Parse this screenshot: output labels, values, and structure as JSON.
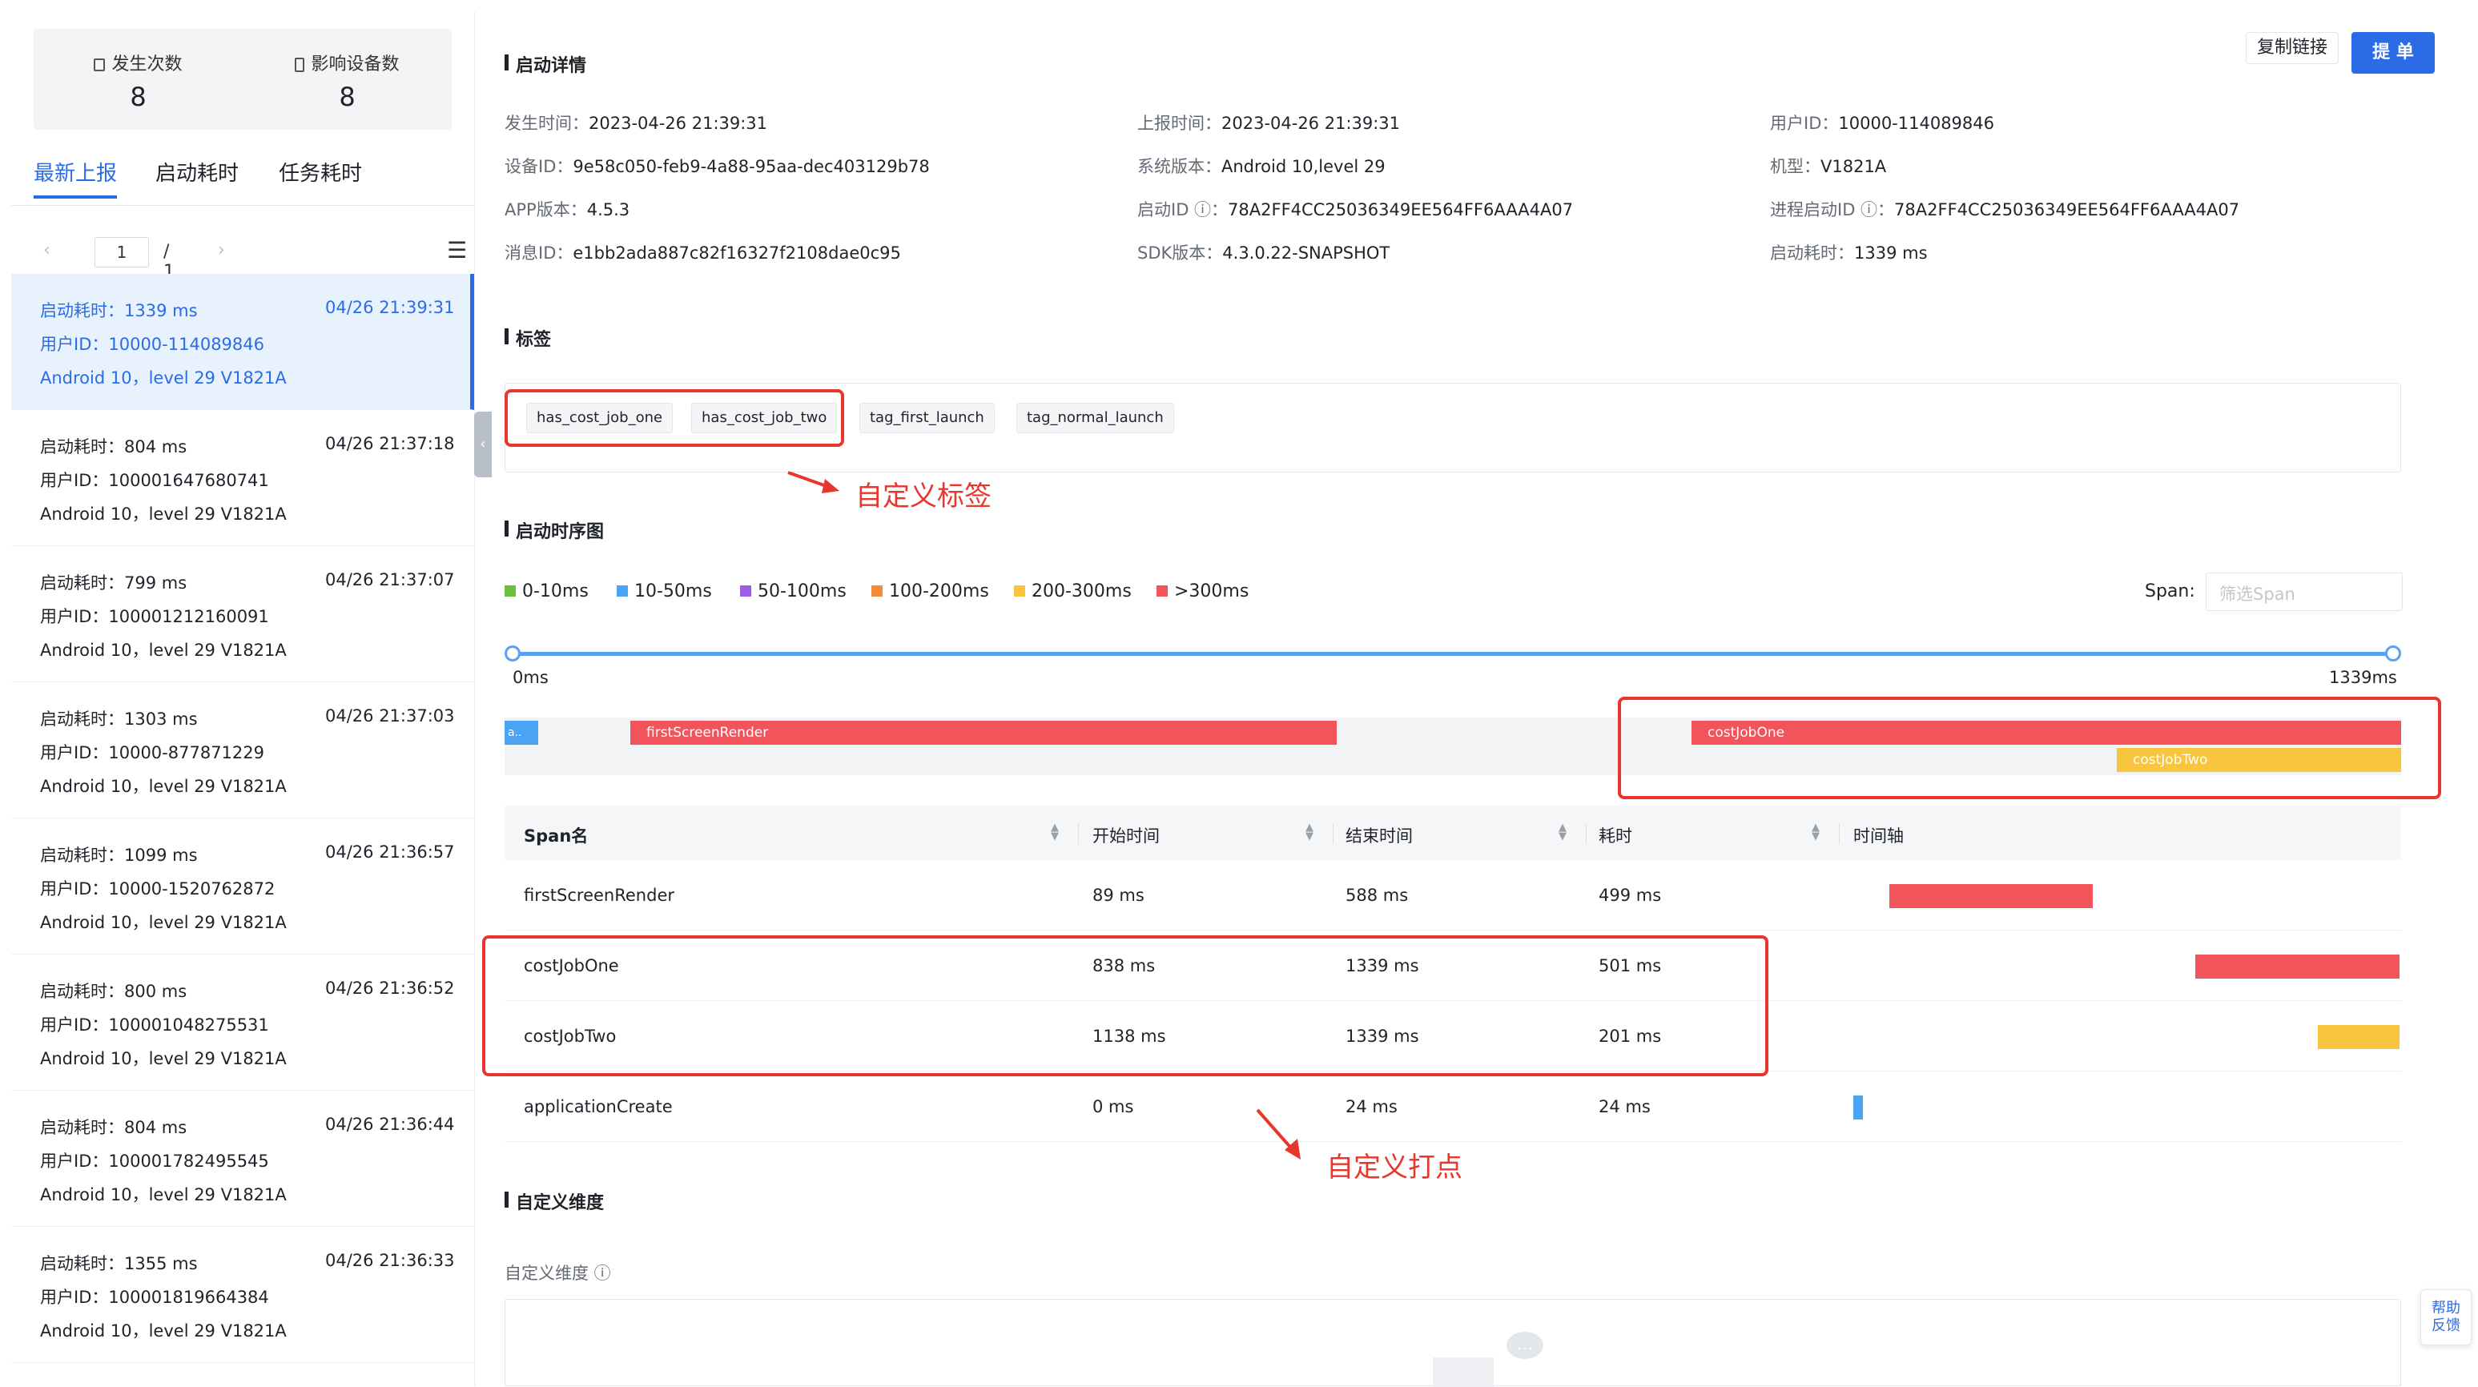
{
  "colors": {
    "accent": "#2b6be6",
    "red": "#f2545b",
    "yellow": "#f9c43e",
    "blue": "#4aa3f5",
    "annotation": "#e8362d"
  },
  "left": {
    "stats": [
      {
        "icon": "lock-icon",
        "label": "发生次数",
        "value": "8"
      },
      {
        "icon": "device-icon",
        "label": "影响设备数",
        "value": "8"
      }
    ],
    "tabs": [
      "最新上报",
      "启动耗时",
      "任务耗时"
    ],
    "pager": {
      "page": "1",
      "total": "/ 1"
    },
    "items": [
      {
        "cost": "启动耗时：1339 ms",
        "time": "04/26 21:39:31",
        "user": "用户ID：10000-114089846",
        "device": "Android 10，level 29    V1821A"
      },
      {
        "cost": "启动耗时：804 ms",
        "time": "04/26 21:37:18",
        "user": "用户ID：100001647680741",
        "device": "Android 10，level 29    V1821A"
      },
      {
        "cost": "启动耗时：799 ms",
        "time": "04/26 21:37:07",
        "user": "用户ID：100001212160091",
        "device": "Android 10，level 29    V1821A"
      },
      {
        "cost": "启动耗时：1303 ms",
        "time": "04/26 21:37:03",
        "user": "用户ID：10000-877871229",
        "device": "Android 10，level 29    V1821A"
      },
      {
        "cost": "启动耗时：1099 ms",
        "time": "04/26 21:36:57",
        "user": "用户ID：10000-1520762872",
        "device": "Android 10，level 29    V1821A"
      },
      {
        "cost": "启动耗时：800 ms",
        "time": "04/26 21:36:52",
        "user": "用户ID：100001048275531",
        "device": "Android 10，level 29    V1821A"
      },
      {
        "cost": "启动耗时：804 ms",
        "time": "04/26 21:36:44",
        "user": "用户ID：100001782495545",
        "device": "Android 10，level 29    V1821A"
      },
      {
        "cost": "启动耗时：1355 ms",
        "time": "04/26 21:36:33",
        "user": "用户ID：100001819664384",
        "device": "Android 10，level 29    V1821A"
      }
    ]
  },
  "main": {
    "detail_title": "启动详情",
    "copy_link": "复制链接",
    "submit": "提 单",
    "details": [
      {
        "k": "发生时间：",
        "v": "2023-04-26 21:39:31"
      },
      {
        "k": "上报时间：",
        "v": "2023-04-26 21:39:31"
      },
      {
        "k": "用户ID：",
        "v": "10000-114089846"
      },
      {
        "k": "设备ID：",
        "v": "9e58c050-feb9-4a88-95aa-dec403129b78"
      },
      {
        "k": "系统版本：",
        "v": "Android 10,level 29"
      },
      {
        "k": "机型：",
        "v": "V1821A"
      },
      {
        "k": "APP版本：",
        "v": "4.5.3"
      },
      {
        "k": "启动ID ⓘ：",
        "v": "78A2FF4CC25036349EE564FF6AAA4A07"
      },
      {
        "k": "进程启动ID ⓘ：",
        "v": "78A2FF4CC25036349EE564FF6AAA4A07"
      },
      {
        "k": "消息ID：",
        "v": "e1bb2ada887c82f16327f2108dae0c95"
      },
      {
        "k": "SDK版本：",
        "v": "4.3.0.22-SNAPSHOT"
      },
      {
        "k": "启动耗时：",
        "v": "1339 ms"
      }
    ],
    "tags_title": "标签",
    "tags": [
      "has_cost_job_one",
      "has_cost_job_two",
      "tag_first_launch",
      "tag_normal_launch"
    ],
    "tag_annotation": "自定义标签",
    "timing_title": "启动时序图",
    "legend": [
      {
        "label": "0-10ms",
        "color": "#6cbf3f"
      },
      {
        "label": "10-50ms",
        "color": "#4aa3f5"
      },
      {
        "label": "50-100ms",
        "color": "#9b5de5"
      },
      {
        "label": "100-200ms",
        "color": "#f28c38"
      },
      {
        "label": "200-300ms",
        "color": "#f9c43e"
      },
      {
        "label": ">300ms",
        "color": "#f2545b"
      }
    ],
    "span_label": "Span:",
    "span_placeholder": "筛选Span",
    "range_start": "0ms",
    "range_end": "1339ms",
    "gantt": {
      "total_ms": 1339,
      "bars": [
        {
          "label": "a..",
          "start": 0,
          "end": 24,
          "color": "#4aa3f5",
          "row": 0
        },
        {
          "label": "firstScreenRender",
          "start": 89,
          "end": 588,
          "color": "#f2545b",
          "row": 0
        },
        {
          "label": "costJobOne",
          "start": 838,
          "end": 1339,
          "color": "#f2545b",
          "row": 0
        },
        {
          "label": "costJobTwo",
          "start": 1138,
          "end": 1339,
          "color": "#f9c43e",
          "row": 1
        }
      ]
    },
    "table": {
      "headers": [
        "Span名",
        "开始时间",
        "结束时间",
        "耗时",
        "时间轴"
      ],
      "rows": [
        {
          "name": "firstScreenRender",
          "start": "89 ms",
          "end": "588 ms",
          "cost": "499 ms",
          "s": 89,
          "e": 588,
          "color": "#f2545b"
        },
        {
          "name": "costJobOne",
          "start": "838 ms",
          "end": "1339 ms",
          "cost": "501 ms",
          "s": 838,
          "e": 1339,
          "color": "#f2545b"
        },
        {
          "name": "costJobTwo",
          "start": "1138 ms",
          "end": "1339 ms",
          "cost": "201 ms",
          "s": 1138,
          "e": 1339,
          "color": "#f9c43e"
        },
        {
          "name": "applicationCreate",
          "start": "0 ms",
          "end": "24 ms",
          "cost": "24 ms",
          "s": 0,
          "e": 24,
          "color": "#4aa3f5"
        }
      ]
    },
    "span_annotation": "自定义打点",
    "dim_title": "自定义维度",
    "dim_label": "自定义维度 ⓘ"
  },
  "help": {
    "line1": "帮助",
    "line2": "反馈"
  }
}
